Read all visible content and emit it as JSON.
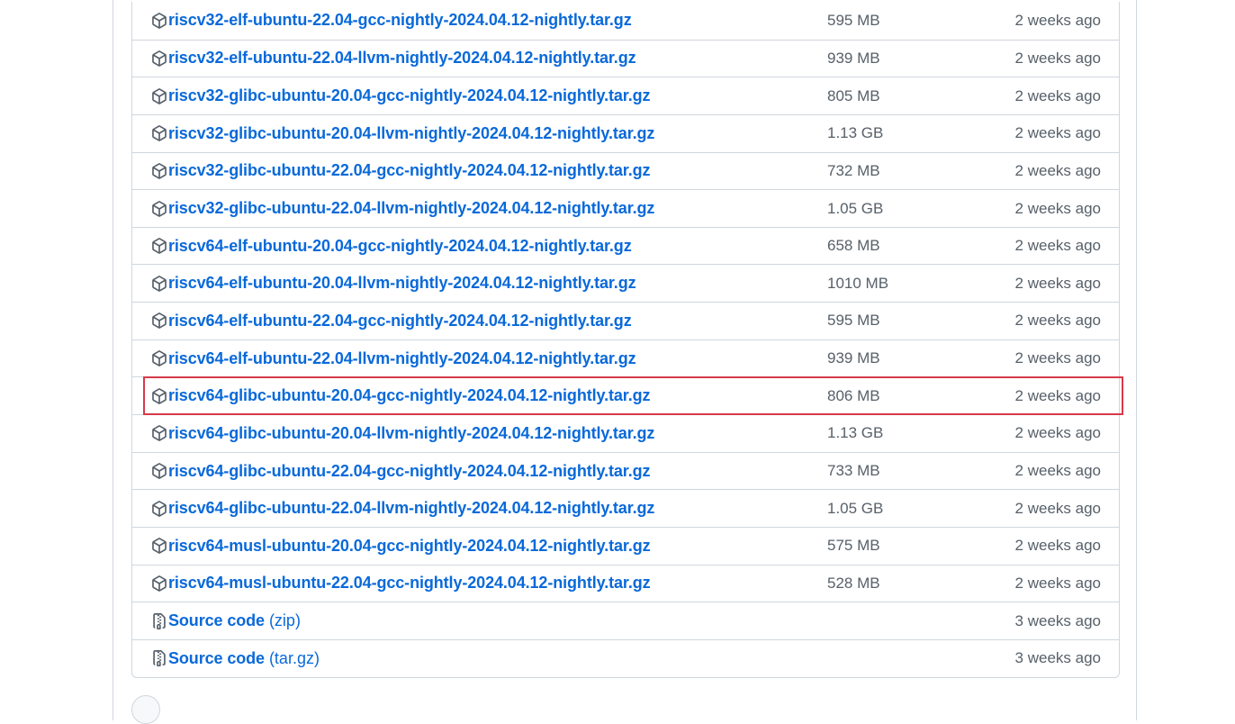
{
  "assets": [
    {
      "name": "riscv32-elf-ubuntu-22.04-gcc-nightly-2024.04.12-nightly.tar.gz",
      "size": "595 MB",
      "date": "2 weeks ago",
      "icon": "package-icon"
    },
    {
      "name": "riscv32-elf-ubuntu-22.04-llvm-nightly-2024.04.12-nightly.tar.gz",
      "size": "939 MB",
      "date": "2 weeks ago",
      "icon": "package-icon"
    },
    {
      "name": "riscv32-glibc-ubuntu-20.04-gcc-nightly-2024.04.12-nightly.tar.gz",
      "size": "805 MB",
      "date": "2 weeks ago",
      "icon": "package-icon"
    },
    {
      "name": "riscv32-glibc-ubuntu-20.04-llvm-nightly-2024.04.12-nightly.tar.gz",
      "size": "1.13 GB",
      "date": "2 weeks ago",
      "icon": "package-icon"
    },
    {
      "name": "riscv32-glibc-ubuntu-22.04-gcc-nightly-2024.04.12-nightly.tar.gz",
      "size": "732 MB",
      "date": "2 weeks ago",
      "icon": "package-icon"
    },
    {
      "name": "riscv32-glibc-ubuntu-22.04-llvm-nightly-2024.04.12-nightly.tar.gz",
      "size": "1.05 GB",
      "date": "2 weeks ago",
      "icon": "package-icon"
    },
    {
      "name": "riscv64-elf-ubuntu-20.04-gcc-nightly-2024.04.12-nightly.tar.gz",
      "size": "658 MB",
      "date": "2 weeks ago",
      "icon": "package-icon"
    },
    {
      "name": "riscv64-elf-ubuntu-20.04-llvm-nightly-2024.04.12-nightly.tar.gz",
      "size": "1010 MB",
      "date": "2 weeks ago",
      "icon": "package-icon"
    },
    {
      "name": "riscv64-elf-ubuntu-22.04-gcc-nightly-2024.04.12-nightly.tar.gz",
      "size": "595 MB",
      "date": "2 weeks ago",
      "icon": "package-icon"
    },
    {
      "name": "riscv64-elf-ubuntu-22.04-llvm-nightly-2024.04.12-nightly.tar.gz",
      "size": "939 MB",
      "date": "2 weeks ago",
      "icon": "package-icon"
    },
    {
      "name": "riscv64-glibc-ubuntu-20.04-gcc-nightly-2024.04.12-nightly.tar.gz",
      "size": "806 MB",
      "date": "2 weeks ago",
      "icon": "package-icon"
    },
    {
      "name": "riscv64-glibc-ubuntu-20.04-llvm-nightly-2024.04.12-nightly.tar.gz",
      "size": "1.13 GB",
      "date": "2 weeks ago",
      "icon": "package-icon"
    },
    {
      "name": "riscv64-glibc-ubuntu-22.04-gcc-nightly-2024.04.12-nightly.tar.gz",
      "size": "733 MB",
      "date": "2 weeks ago",
      "icon": "package-icon"
    },
    {
      "name": "riscv64-glibc-ubuntu-22.04-llvm-nightly-2024.04.12-nightly.tar.gz",
      "size": "1.05 GB",
      "date": "2 weeks ago",
      "icon": "package-icon"
    },
    {
      "name": "riscv64-musl-ubuntu-20.04-gcc-nightly-2024.04.12-nightly.tar.gz",
      "size": "575 MB",
      "date": "2 weeks ago",
      "icon": "package-icon"
    },
    {
      "name": "riscv64-musl-ubuntu-22.04-gcc-nightly-2024.04.12-nightly.tar.gz",
      "size": "528 MB",
      "date": "2 weeks ago",
      "icon": "package-icon"
    }
  ],
  "sources": [
    {
      "name": "Source code",
      "suffix": "(zip)",
      "date": "3 weeks ago",
      "icon": "file-zip-icon"
    },
    {
      "name": "Source code",
      "suffix": "(tar.gz)",
      "date": "3 weeks ago",
      "icon": "file-zip-icon"
    }
  ],
  "colors": {
    "link": "#0969da",
    "muted": "#57606a",
    "border": "#d0d7de",
    "highlight": "#d73a4a"
  }
}
